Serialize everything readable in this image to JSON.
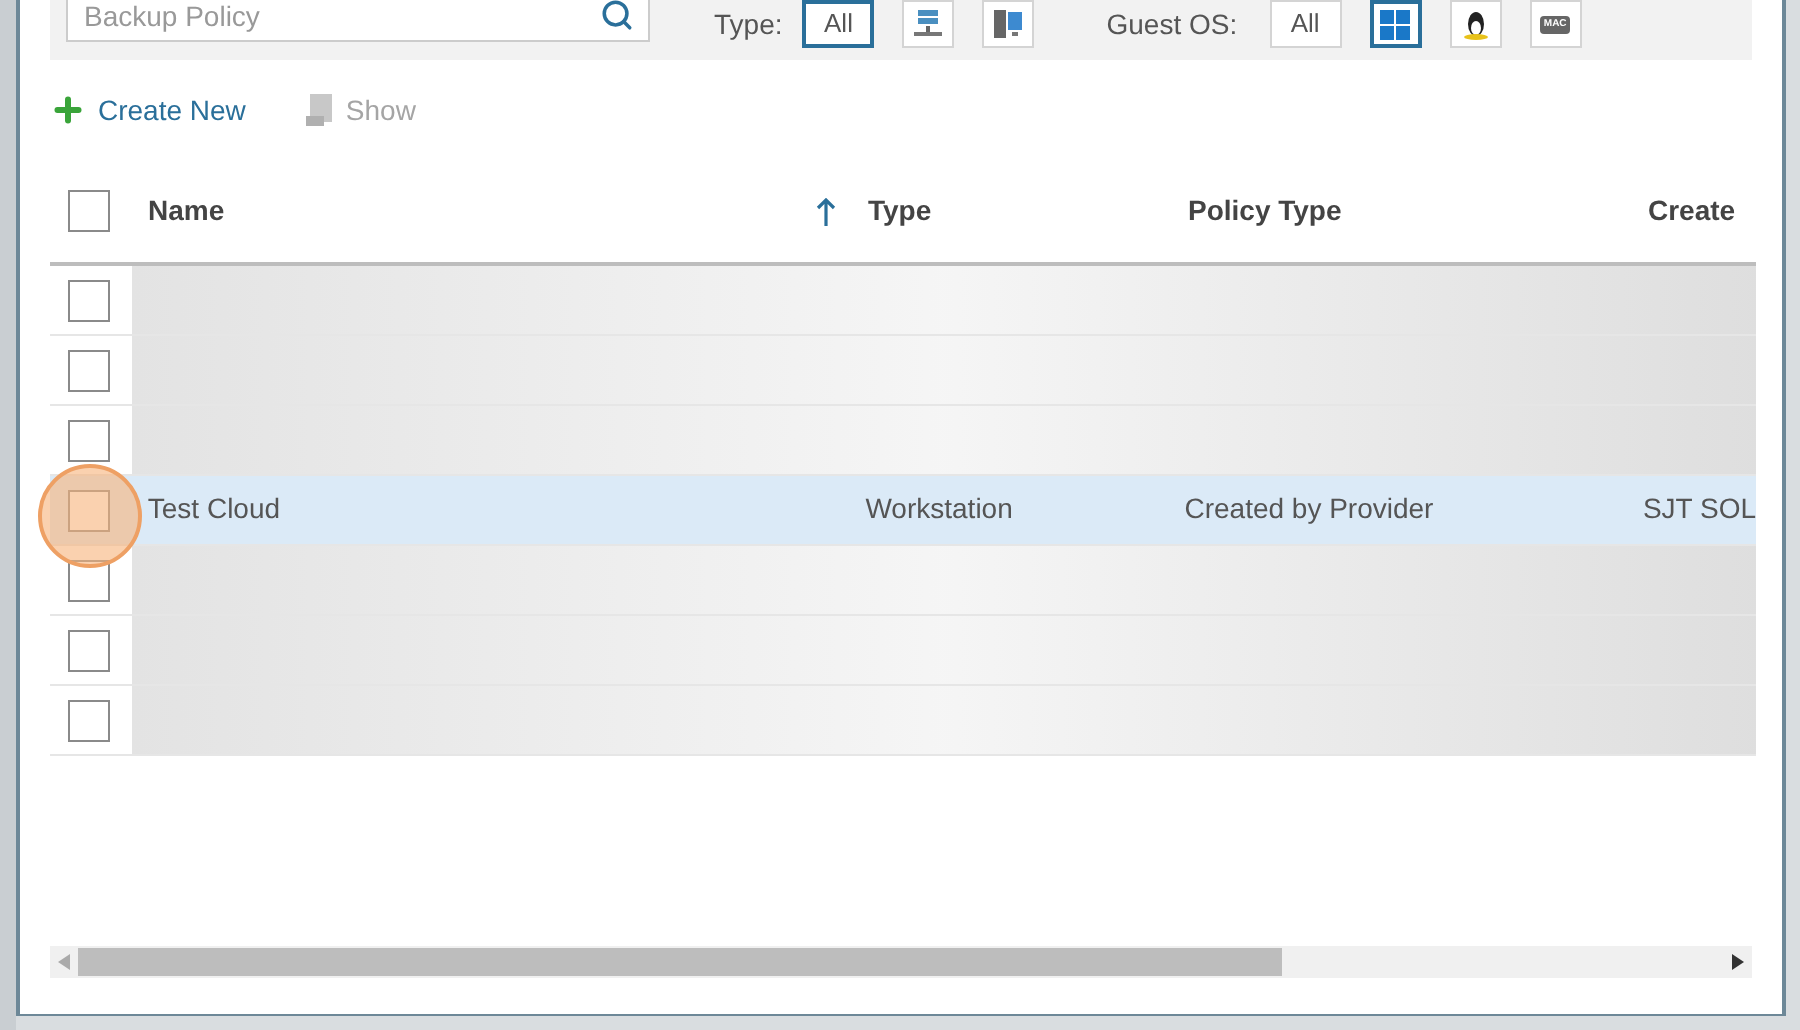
{
  "filter_bar": {
    "search": {
      "placeholder": "Backup Policy"
    },
    "type_label": "Type:",
    "type_filters": [
      {
        "kind": "text",
        "label": "All",
        "selected": true
      },
      {
        "kind": "server",
        "selected": false
      },
      {
        "kind": "workstation",
        "selected": false
      }
    ],
    "guest_os_label": "Guest OS:",
    "os_filters": [
      {
        "kind": "text",
        "label": "All",
        "selected": false
      },
      {
        "kind": "windows",
        "selected": true
      },
      {
        "kind": "linux",
        "selected": false
      },
      {
        "kind": "mac",
        "label": "MAC",
        "selected": false
      }
    ]
  },
  "toolbar": [
    {
      "kind": "create",
      "label": "Create New",
      "disabled": false
    },
    {
      "kind": "show",
      "label": "Show",
      "disabled": true
    }
  ],
  "table": {
    "all_checked": false,
    "columns": [
      {
        "label": "Name",
        "sorted": true
      },
      {
        "label": "Type",
        "sorted": false
      },
      {
        "label": "Policy Type",
        "sorted": false
      },
      {
        "label": "Create",
        "sorted": false
      }
    ],
    "rows": [
      {
        "kind": "blurred",
        "checked": false,
        "selected": false
      },
      {
        "kind": "blurred",
        "checked": false,
        "selected": false
      },
      {
        "kind": "blurred",
        "checked": false,
        "selected": false
      },
      {
        "kind": "data",
        "checked": false,
        "selected": true,
        "clicked": true,
        "cells": [
          "Test Cloud",
          "Workstation",
          "Created by Provider",
          "SJT SOL"
        ]
      },
      {
        "kind": "blurred",
        "checked": false,
        "selected": false
      },
      {
        "kind": "blurred",
        "checked": false,
        "selected": false
      },
      {
        "kind": "blurred",
        "checked": false,
        "selected": false
      }
    ]
  }
}
